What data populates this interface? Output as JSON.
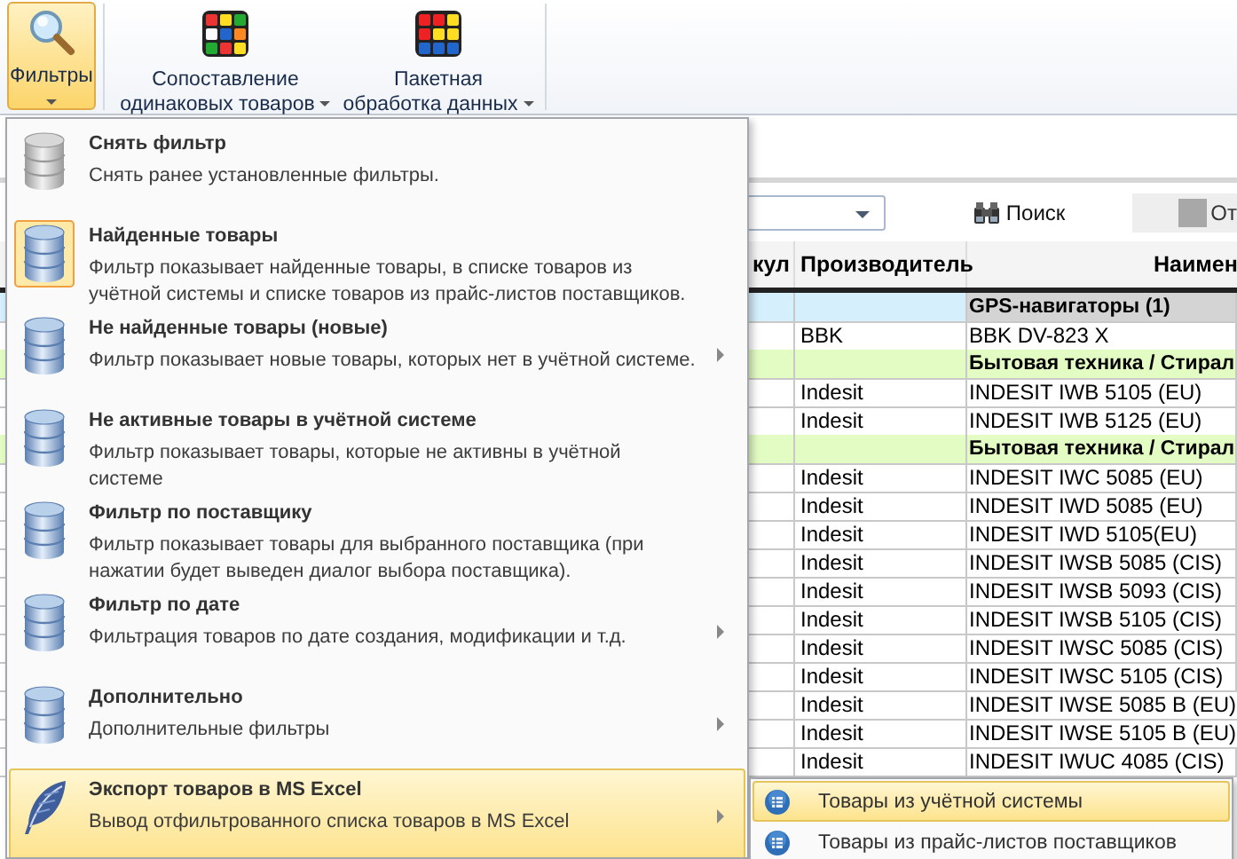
{
  "ribbon": {
    "buttons": [
      {
        "label": "Фильтры",
        "kind": "magnifier",
        "selected": true
      },
      {
        "label": "Сопоставление\nодинаковых товаров",
        "kind": "scrambled",
        "selected": false
      },
      {
        "label": "Пакетная\nобработка данных",
        "kind": "cube",
        "selected": false
      }
    ]
  },
  "toolbar": {
    "search_button": "Поиск",
    "cancel_button": "От"
  },
  "grid": {
    "columns": [
      "кул",
      "Производитель",
      "Наимен"
    ],
    "rows": [
      {
        "kind": "group",
        "label": "GPS-навигаторы (1)",
        "color": "#d4d4d4",
        "selected": true
      },
      {
        "kind": "item",
        "maker": "BBK",
        "name": "BBK DV-823 X",
        "selected": false
      },
      {
        "kind": "group",
        "label": "Бытовая техника / Стирал",
        "color": "#e3fcc4",
        "selected": false
      },
      {
        "kind": "item",
        "maker": "Indesit",
        "name": "INDESIT IWB 5105 (EU)",
        "selected": false
      },
      {
        "kind": "item",
        "maker": "Indesit",
        "name": "INDESIT IWB 5125 (EU)",
        "selected": false
      },
      {
        "kind": "group",
        "label": "Бытовая техника / Стирал",
        "color": "#e3fcc4",
        "selected": false
      },
      {
        "kind": "item",
        "maker": "Indesit",
        "name": "INDESIT IWC 5085 (EU)",
        "selected": false
      },
      {
        "kind": "item",
        "maker": "Indesit",
        "name": "INDESIT IWD 5085 (EU)",
        "selected": false
      },
      {
        "kind": "item",
        "maker": "Indesit",
        "name": "INDESIT IWD 5105(EU)",
        "selected": false
      },
      {
        "kind": "item",
        "maker": "Indesit",
        "name": "INDESIT IWSB 5085 (CIS)",
        "selected": false
      },
      {
        "kind": "item",
        "maker": "Indesit",
        "name": "INDESIT IWSB 5093 (CIS)",
        "selected": false
      },
      {
        "kind": "item",
        "maker": "Indesit",
        "name": "INDESIT IWSB 5105 (CIS)",
        "selected": false
      },
      {
        "kind": "item",
        "maker": "Indesit",
        "name": "INDESIT IWSC 5085 (CIS)",
        "selected": false
      },
      {
        "kind": "item",
        "maker": "Indesit",
        "name": "INDESIT IWSC 5105 (CIS)",
        "selected": false
      },
      {
        "kind": "item",
        "maker": "Indesit",
        "name": "INDESIT IWSE 5085 B (EU)",
        "selected": false
      },
      {
        "kind": "item",
        "maker": "Indesit",
        "name": "INDESIT IWSE 5105 B (EU)",
        "selected": false
      },
      {
        "kind": "item",
        "maker": "Indesit",
        "name": "INDESIT IWUC 4085 (CIS)",
        "selected": false
      }
    ]
  },
  "menu": {
    "items": [
      {
        "title": "Снять фильтр",
        "description": "Снять ранее установленные фильтры.",
        "kind": "grey",
        "checked": false,
        "submenu": false,
        "selected": false
      },
      {
        "title": "Найденные товары",
        "description": "Фильтр показывает найденные товары, в списке товаров из учётной системы и списке товаров из прайс-листов поставщиков.",
        "kind": "database",
        "checked": true,
        "submenu": false,
        "selected": false
      },
      {
        "title": "Не найденные товары (новые)",
        "description": "Фильтр показывает новые товары, которых нет в учётной системе.",
        "kind": "database",
        "checked": false,
        "submenu": true,
        "selected": false
      },
      {
        "title": "Не активные товары в учётной системе",
        "description": "Фильтр показывает товары, которые не активны в учётной системе",
        "kind": "database",
        "checked": false,
        "submenu": false,
        "selected": false
      },
      {
        "title": "Фильтр по поставщику",
        "description": "Фильтр показывает товары для выбранного поставщика (при нажатии будет выведен диалог выбора поставщика).",
        "kind": "database",
        "checked": false,
        "submenu": false,
        "selected": false
      },
      {
        "title": "Фильтр по дате",
        "description": "Фильтрация товаров по дате создания, модификации и т.д.",
        "kind": "database",
        "checked": false,
        "submenu": true,
        "selected": false
      },
      {
        "title": "Дополнительно",
        "description": "Дополнительные фильтры",
        "kind": "database",
        "checked": false,
        "submenu": true,
        "selected": false
      },
      {
        "title": "Экспорт товаров в MS Excel",
        "description": "Вывод отфильтрованного списка товаров в MS Excel",
        "kind": "feather",
        "checked": false,
        "submenu": true,
        "selected": true
      }
    ]
  },
  "submenu": {
    "items": [
      {
        "label": "Товары из учётной системы",
        "selected": true
      },
      {
        "label": "Товары из прайс-листов поставщиков",
        "selected": false
      }
    ]
  }
}
